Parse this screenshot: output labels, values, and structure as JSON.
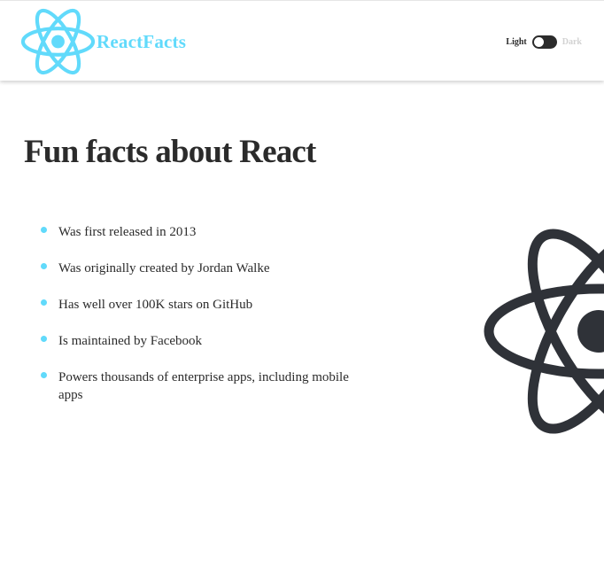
{
  "brand": {
    "name": "ReactFacts",
    "logo_icon": "react-atom-icon",
    "color": "#61dafb"
  },
  "toggle": {
    "light_label": "Light",
    "dark_label": "Dark",
    "state": "light"
  },
  "main": {
    "title": "Fun facts about React",
    "facts": [
      "Was first released in 2013",
      "Was originally created by Jordan Walke",
      "Has well over 100K stars on GitHub",
      "Is maintained by Facebook",
      "Powers thousands of enterprise apps, including mobile apps"
    ],
    "background_icon": "react-atom-icon"
  },
  "colors": {
    "accent": "#61dafb",
    "text": "#2b2b2b",
    "muted": "#d2d2d2",
    "background": "#ffffff"
  }
}
